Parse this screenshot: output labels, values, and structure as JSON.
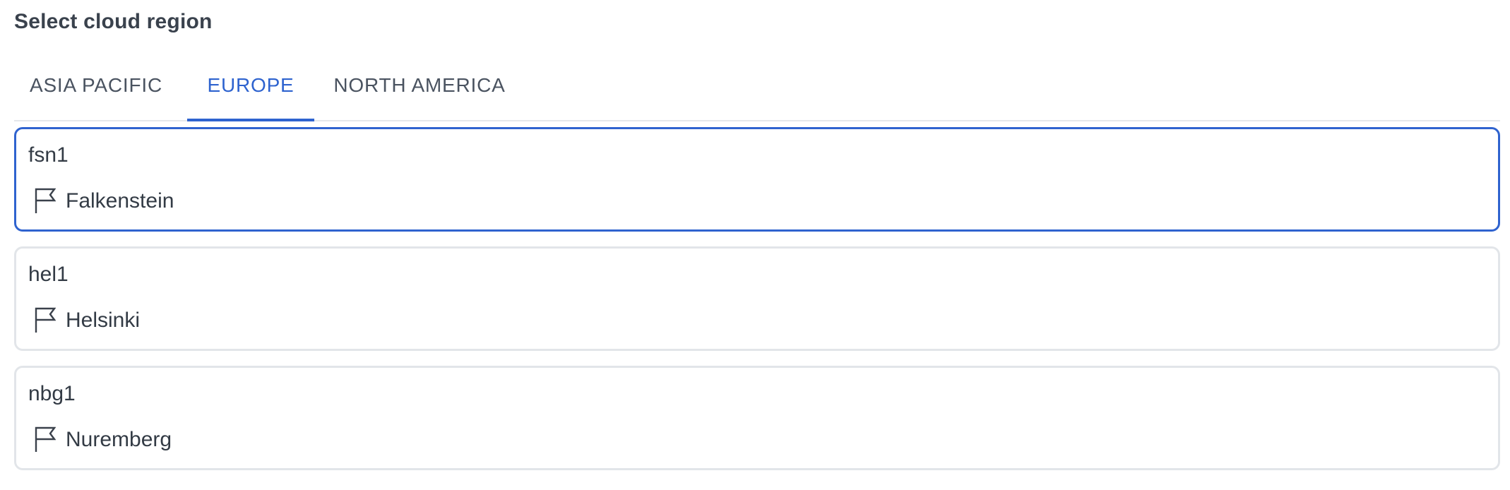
{
  "heading": "Select cloud region",
  "tabs": [
    {
      "label": "ASIA PACIFIC",
      "active": false
    },
    {
      "label": "EUROPE",
      "active": true
    },
    {
      "label": "NORTH AMERICA",
      "active": false
    }
  ],
  "regions": [
    {
      "code": "fsn1",
      "location": "Falkenstein",
      "icon": "flag-icon",
      "selected": true
    },
    {
      "code": "hel1",
      "location": "Helsinki",
      "icon": "flag-icon",
      "selected": false
    },
    {
      "code": "nbg1",
      "location": "Nuremberg",
      "icon": "flag-icon",
      "selected": false
    }
  ],
  "colors": {
    "accent": "#2e63cf",
    "text": "#3a414b",
    "border": "#e2e5e9"
  }
}
